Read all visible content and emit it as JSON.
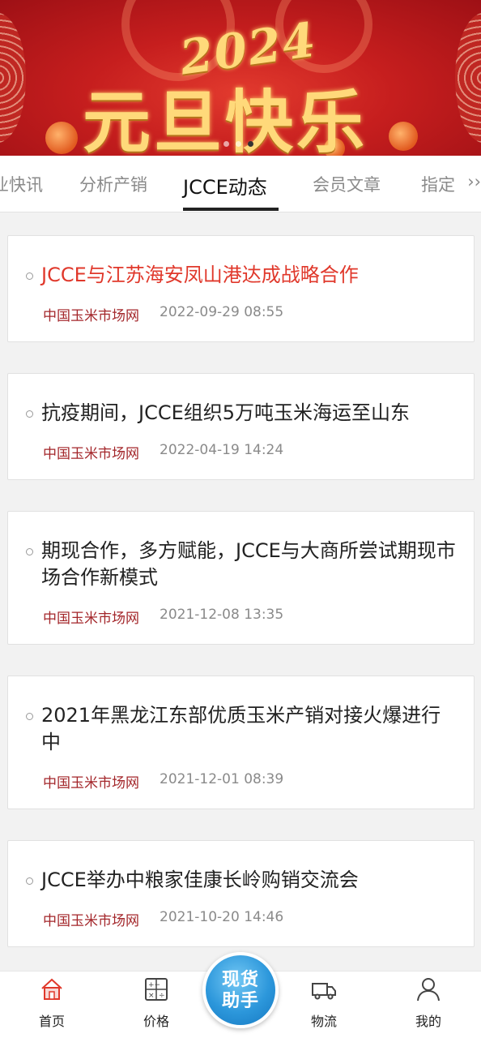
{
  "banner": {
    "year": "2024",
    "greeting": "元旦快乐"
  },
  "tabs": {
    "items": [
      "业快讯",
      "分析产销",
      "JCCE动态",
      "会员文章",
      "指定"
    ],
    "more": "›› "
  },
  "articles": [
    {
      "title": "JCCE与江苏海安凤山港达成战略合作",
      "source": "中国玉米市场网",
      "time": "2022-09-29 08:55",
      "highlight": true
    },
    {
      "title": "抗疫期间，JCCE组织5万吨玉米海运至山东",
      "source": "中国玉米市场网",
      "time": "2022-04-19 14:24"
    },
    {
      "title": "期现合作，多方赋能，JCCE与大商所尝试期现市场合作新模式",
      "source": "中国玉米市场网",
      "time": "2021-12-08 13:35"
    },
    {
      "title": "2021年黑龙江东部优质玉米产销对接火爆进行中",
      "source": "中国玉米市场网",
      "time": "2021-12-01 08:39"
    },
    {
      "title": "JCCE举办中粮家佳康长岭购销交流会",
      "source": "中国玉米市场网",
      "time": "2021-10-20 14:46"
    }
  ],
  "bottom_nav": {
    "home": "首页",
    "price": "价格",
    "fab_line1": "现货",
    "fab_line2": "助手",
    "logistics": "物流",
    "mine": "我的"
  },
  "colors": {
    "highlight": "#e0382b",
    "source": "#a3262a",
    "fab": "#2c97db"
  }
}
